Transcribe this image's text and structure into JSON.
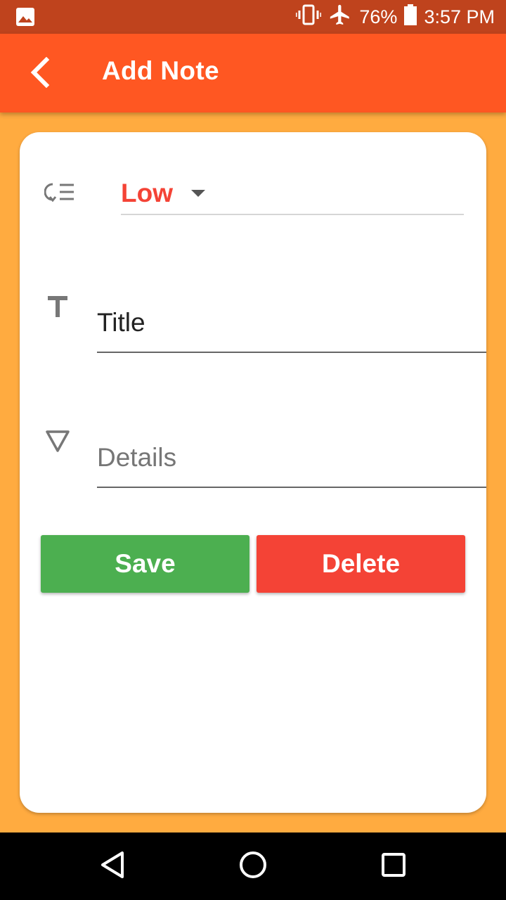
{
  "status_bar": {
    "battery_percent": "76%",
    "time": "3:57 PM",
    "icons": [
      "image-icon",
      "vibrate-icon",
      "airplane-mode-icon",
      "battery-icon"
    ]
  },
  "app_bar": {
    "title": "Add Note",
    "back_icon": "chevron-left-icon"
  },
  "form": {
    "priority": {
      "icon": "priority-list-icon",
      "selected": "Low",
      "selected_color": "#f44336"
    },
    "title": {
      "icon": "text-title-icon",
      "value": "Title",
      "placeholder": "Title"
    },
    "details": {
      "icon": "triangle-down-icon",
      "value": "",
      "placeholder": "Details"
    },
    "save_label": "Save",
    "delete_label": "Delete"
  },
  "colors": {
    "status_bar": "#bf431d",
    "app_bar": "#ff5722",
    "background": "#ffab40",
    "save": "#4caf50",
    "delete": "#f44336"
  },
  "nav_bar": {
    "icons": [
      "back-triangle-icon",
      "home-circle-icon",
      "recents-square-icon"
    ]
  }
}
